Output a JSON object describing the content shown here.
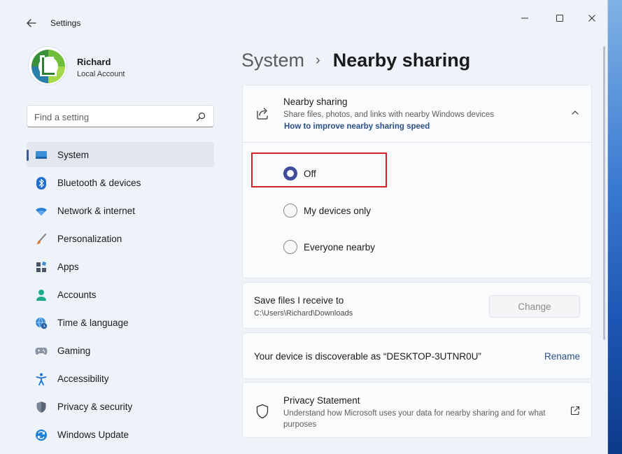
{
  "window": {
    "title": "Settings"
  },
  "profile": {
    "name": "Richard",
    "account_type": "Local Account"
  },
  "search": {
    "placeholder": "Find a setting"
  },
  "sidebar": {
    "items": [
      {
        "label": "System",
        "icon": "monitor-icon",
        "active": true
      },
      {
        "label": "Bluetooth & devices",
        "icon": "bluetooth-icon"
      },
      {
        "label": "Network & internet",
        "icon": "wifi-icon"
      },
      {
        "label": "Personalization",
        "icon": "brush-icon"
      },
      {
        "label": "Apps",
        "icon": "apps-icon"
      },
      {
        "label": "Accounts",
        "icon": "person-icon"
      },
      {
        "label": "Time & language",
        "icon": "globe-clock-icon"
      },
      {
        "label": "Gaming",
        "icon": "gamepad-icon"
      },
      {
        "label": "Accessibility",
        "icon": "accessibility-icon"
      },
      {
        "label": "Privacy & security",
        "icon": "shield-icon"
      },
      {
        "label": "Windows Update",
        "icon": "update-icon"
      }
    ]
  },
  "breadcrumb": {
    "parent": "System",
    "separator": "›",
    "current": "Nearby sharing"
  },
  "nearby_sharing": {
    "title": "Nearby sharing",
    "description": "Share files, photos, and links with nearby Windows devices",
    "link": "How to improve nearby sharing speed",
    "options": [
      {
        "label": "Off",
        "selected": true
      },
      {
        "label": "My devices only",
        "selected": false
      },
      {
        "label": "Everyone nearby",
        "selected": false
      }
    ]
  },
  "save_location": {
    "title": "Save files I receive to",
    "path": "C:\\Users\\Richard\\Downloads",
    "button": "Change"
  },
  "discoverable": {
    "text": "Your device is discoverable as “DESKTOP-3UTNR0U”",
    "button": "Rename"
  },
  "privacy": {
    "title": "Privacy Statement",
    "description": "Understand how Microsoft uses your data for nearby sharing and for what purposes"
  },
  "colors": {
    "accent": "#3f4d9a",
    "highlight": "#d2222a",
    "link": "#2b4f86"
  }
}
